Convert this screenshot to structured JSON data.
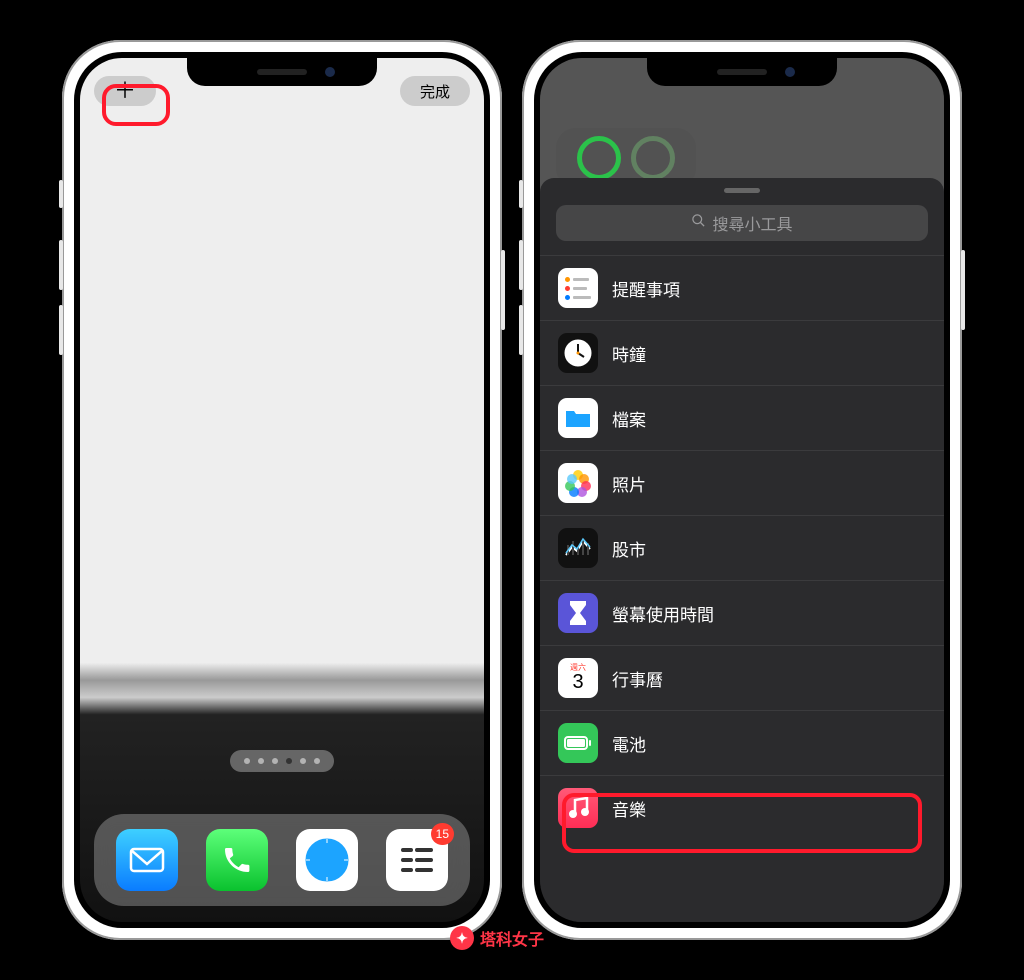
{
  "left": {
    "add_label": "＋",
    "done_label": "完成",
    "dock": {
      "mail": "Mail",
      "phone": "Phone",
      "safari": "Safari",
      "todoist": "Todoist",
      "badge": "15"
    }
  },
  "right": {
    "search_placeholder": "搜尋小工具",
    "items": [
      {
        "id": "reminders",
        "label": "提醒事項"
      },
      {
        "id": "clock",
        "label": "時鐘"
      },
      {
        "id": "files",
        "label": "檔案"
      },
      {
        "id": "photos",
        "label": "照片"
      },
      {
        "id": "stocks",
        "label": "股市"
      },
      {
        "id": "screentime",
        "label": "螢幕使用時間"
      },
      {
        "id": "calendar",
        "label": "行事曆",
        "sub_top": "週六",
        "sub_num": "3"
      },
      {
        "id": "battery",
        "label": "電池"
      },
      {
        "id": "music",
        "label": "音樂"
      }
    ]
  },
  "watermark": "塔科女子"
}
